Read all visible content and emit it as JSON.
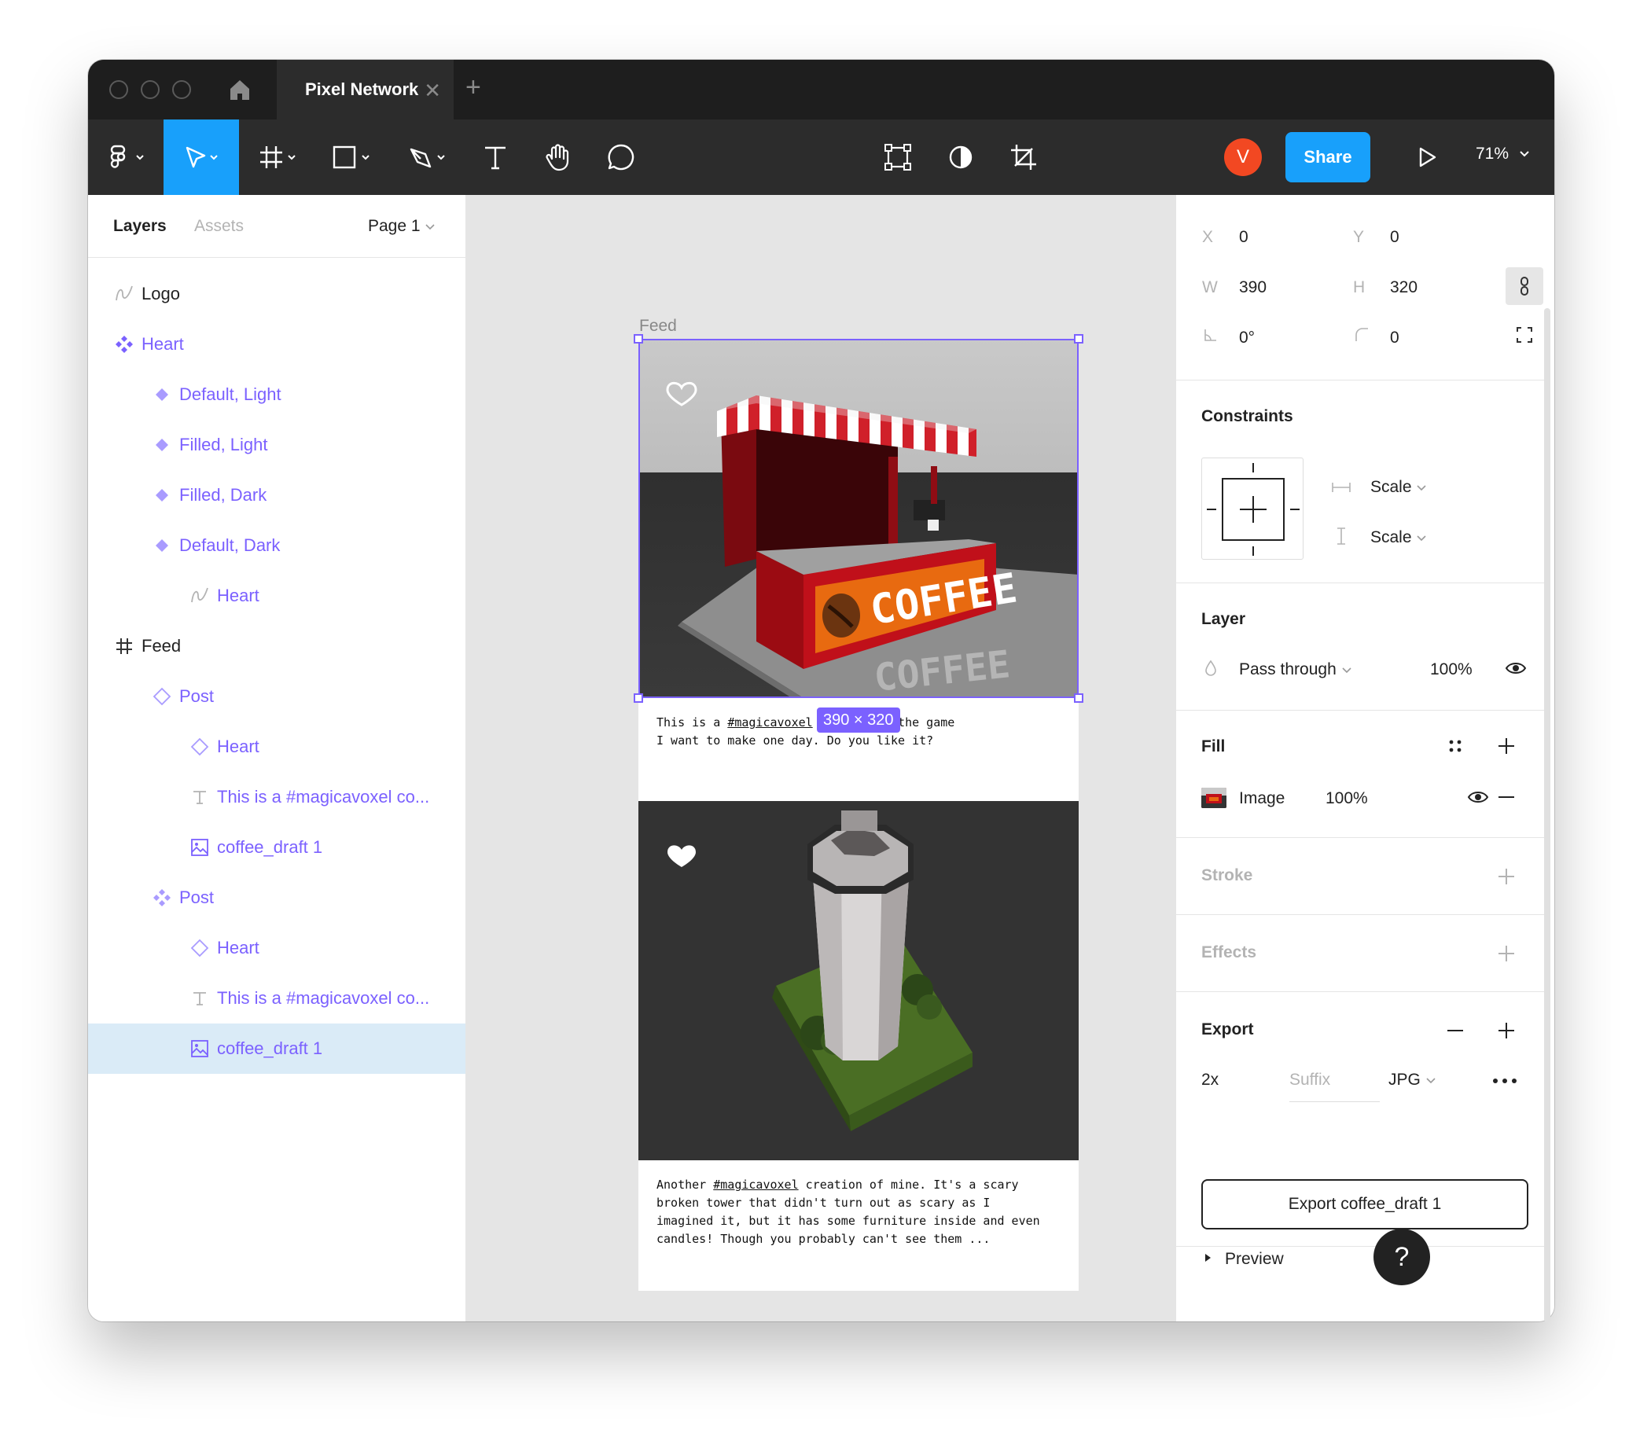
{
  "window": {
    "tab_title": "Pixel Network",
    "tab_close": "✕",
    "new_tab": "+"
  },
  "toolbar": {
    "avatar_initial": "V",
    "share_label": "Share",
    "zoom": "71%"
  },
  "left_panel": {
    "tabs": {
      "layers": "Layers",
      "assets": "Assets"
    },
    "page_selector": "Page 1",
    "layers": [
      {
        "name": "Logo",
        "icon": "vector-icon"
      },
      {
        "name": "Heart",
        "icon": "component-set-icon"
      },
      {
        "name": "Default, Light",
        "icon": "variant-icon"
      },
      {
        "name": "Filled, Light",
        "icon": "variant-icon"
      },
      {
        "name": "Filled, Dark",
        "icon": "variant-icon"
      },
      {
        "name": "Default, Dark",
        "icon": "variant-icon"
      },
      {
        "name": "Heart",
        "icon": "vector-icon"
      },
      {
        "name": "Feed",
        "icon": "frame-icon"
      },
      {
        "name": "Post",
        "icon": "instance-icon"
      },
      {
        "name": "Heart",
        "icon": "instance-icon"
      },
      {
        "name": "This is a #magicavoxel co...",
        "icon": "text-icon"
      },
      {
        "name": "coffee_draft 1",
        "icon": "image-icon"
      },
      {
        "name": "Post",
        "icon": "component-icon"
      },
      {
        "name": "Heart",
        "icon": "instance-icon"
      },
      {
        "name": "This is a #magicavoxel co...",
        "icon": "text-icon"
      },
      {
        "name": "coffee_draft 1",
        "icon": "image-icon"
      }
    ]
  },
  "canvas": {
    "frame_label": "Feed",
    "size_badge": "390 × 320",
    "post1": {
      "text_a": "This is a ",
      "tag": "#magicavoxel",
      "text_b": " I made for the game",
      "text_c": "I want to make one day. Do you like it?",
      "sign_text": "COFFEE"
    },
    "post2": {
      "line1a": "Another ",
      "tag": "#magicavoxel",
      "line1b": " creation of mine. It's a scary",
      "line2": "broken tower that didn't turn out as scary as I",
      "line3": "imagined it, but it has some furniture inside and even",
      "line4": "candles! Though you probably can't see them ..."
    }
  },
  "right_panel": {
    "x_label": "X",
    "x": "0",
    "y_label": "Y",
    "y": "0",
    "w_label": "W",
    "w": "390",
    "h_label": "H",
    "h": "320",
    "rotation": "0°",
    "radius": "0",
    "constraints_title": "Constraints",
    "constraint_h": "Scale",
    "constraint_v": "Scale",
    "layer_title": "Layer",
    "blend_mode": "Pass through",
    "layer_opacity": "100%",
    "fill_title": "Fill",
    "fill_type": "Image",
    "fill_opacity": "100%",
    "stroke_title": "Stroke",
    "effects_title": "Effects",
    "export_title": "Export",
    "export_scale": "2x",
    "export_suffix_placeholder": "Suffix",
    "export_format": "JPG",
    "export_button": "Export coffee_draft 1",
    "preview_label": "Preview"
  },
  "help_label": "?"
}
